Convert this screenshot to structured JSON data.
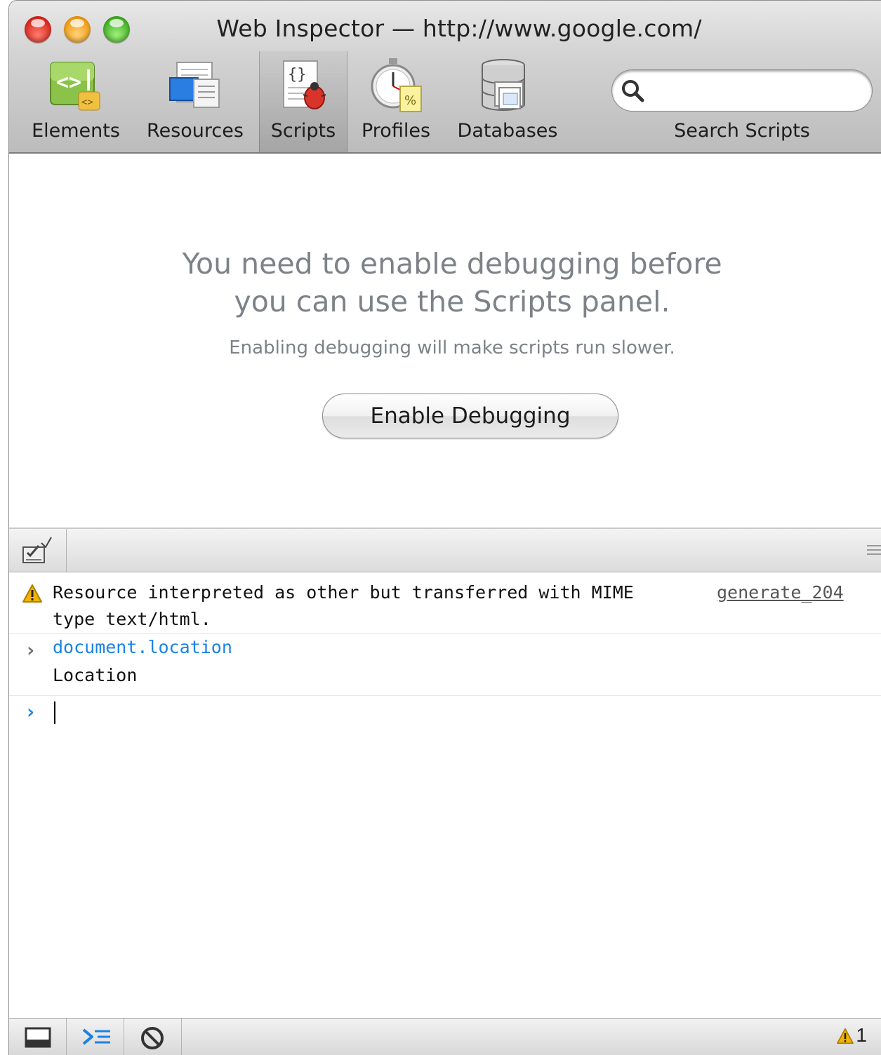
{
  "window": {
    "title": "Web Inspector — http://www.google.com/"
  },
  "toolbar": {
    "items": [
      {
        "label": "Elements",
        "icon": "elements-icon",
        "selected": false
      },
      {
        "label": "Resources",
        "icon": "resources-icon",
        "selected": false
      },
      {
        "label": "Scripts",
        "icon": "scripts-icon",
        "selected": true
      },
      {
        "label": "Profiles",
        "icon": "profiles-icon",
        "selected": false
      },
      {
        "label": "Databases",
        "icon": "databases-icon",
        "selected": false
      }
    ],
    "search": {
      "label": "Search Scripts",
      "value": "",
      "placeholder": ""
    }
  },
  "scripts_panel": {
    "message_line1": "You need to enable debugging before",
    "message_line2": "you can use the Scripts panel.",
    "note": "Enabling debugging will make scripts run slower.",
    "enable_button": "Enable Debugging"
  },
  "console": {
    "entries": [
      {
        "type": "warning",
        "text": "Resource interpreted as other but transferred with MIME\ntype text/html.",
        "source": "generate_204"
      },
      {
        "type": "command",
        "command": "document.location",
        "result": "Location"
      }
    ],
    "prompt_value": ""
  },
  "status_bar": {
    "warning_count": "1"
  },
  "colors": {
    "console_command": "#1a82e6",
    "warning_yellow": "#f2b400",
    "message_gray": "#7d8288"
  }
}
